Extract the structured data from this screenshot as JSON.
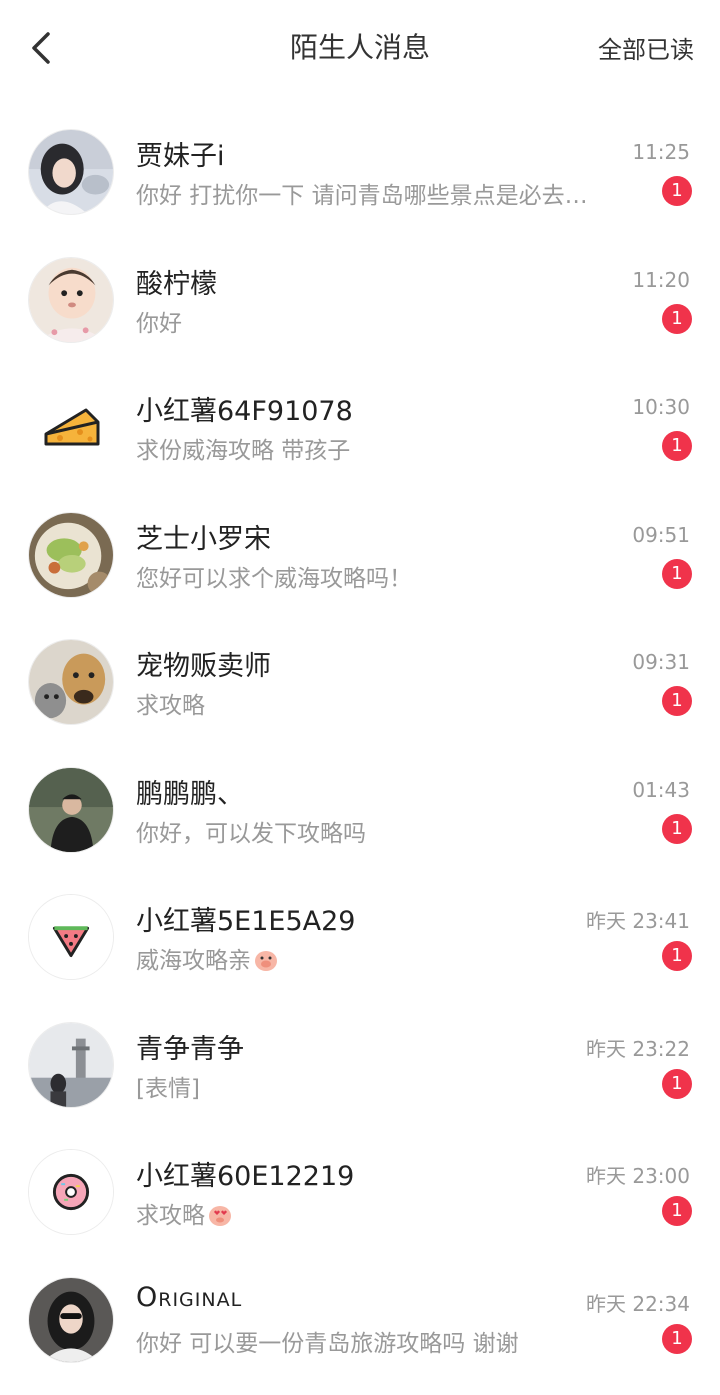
{
  "header": {
    "title": "陌生人消息",
    "mark_all_read": "全部已读"
  },
  "colors": {
    "badge": "#f0334b",
    "secondary_text": "#999999"
  },
  "messages": [
    {
      "name": "贾妹子i",
      "preview": "你好 打扰你一下 请问青岛哪些景点是必去…",
      "time": "11:25",
      "unread": "1",
      "avatar": "girl-photo"
    },
    {
      "name": "酸柠檬",
      "preview": "你好",
      "time": "11:20",
      "unread": "1",
      "avatar": "baby-photo"
    },
    {
      "name": "小红薯64F91078",
      "preview": "求份威海攻略 带孩子",
      "time": "10:30",
      "unread": "1",
      "avatar": "cheese-icon"
    },
    {
      "name": "芝士小罗宋",
      "preview": "您好可以求个威海攻略吗！",
      "time": "09:51",
      "unread": "1",
      "avatar": "food-photo"
    },
    {
      "name": "宠物贩卖师",
      "preview": "求攻略",
      "time": "09:31",
      "unread": "1",
      "avatar": "pets-photo"
    },
    {
      "name": "鹏鹏鹏、",
      "preview": "你好，可以发下攻略吗",
      "time": "01:43",
      "unread": "1",
      "avatar": "man-photo"
    },
    {
      "name": "小红薯5E1E5A29",
      "preview": "威海攻略亲",
      "time": "昨天 23:41",
      "unread": "1",
      "avatar": "watermelon-icon"
    },
    {
      "name": "青争青争",
      "preview": "[表情]",
      "time": "昨天 23:22",
      "unread": "1",
      "avatar": "tower-photo"
    },
    {
      "name": "小红薯60E12219",
      "preview": "求攻略",
      "time": "昨天 23:00",
      "unread": "1",
      "avatar": "donut-icon"
    },
    {
      "name": "Original",
      "preview": "你好 可以要一份青岛旅游攻略吗 谢谢",
      "time": "昨天 22:34",
      "unread": "1",
      "avatar": "woman-photo"
    }
  ]
}
